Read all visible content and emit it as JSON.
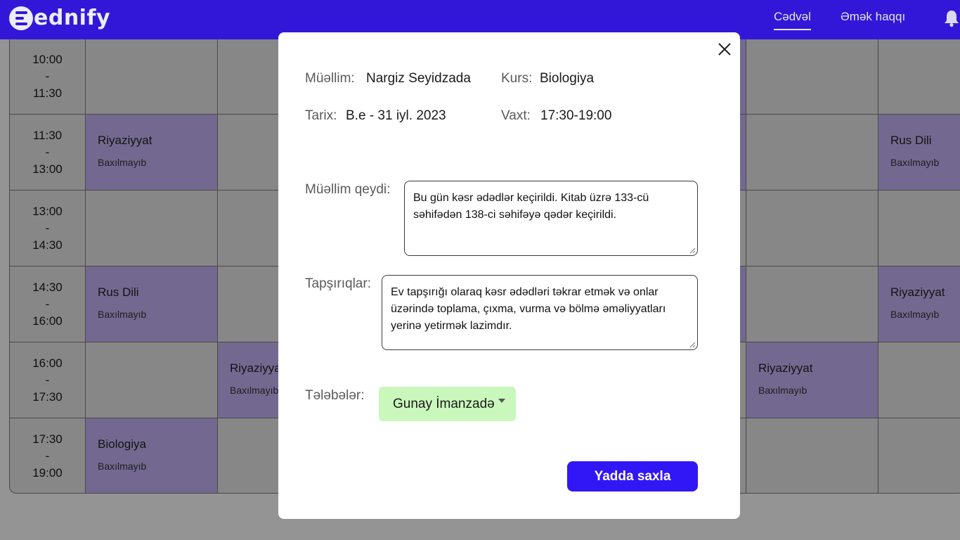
{
  "app": {
    "logo_text": "ednify",
    "nav": {
      "schedule": "Cədvəl",
      "salary": "Əmək haqqı"
    },
    "brand_color": "#3217d8"
  },
  "schedule": {
    "times": [
      {
        "start": "10:00",
        "sep": "-",
        "end": "11:30"
      },
      {
        "start": "11:30",
        "sep": "-",
        "end": "13:00"
      },
      {
        "start": "13:00",
        "sep": "-",
        "end": "14:30"
      },
      {
        "start": "14:30",
        "sep": "-",
        "end": "16:00"
      },
      {
        "start": "16:00",
        "sep": "-",
        "end": "17:30"
      },
      {
        "start": "17:30",
        "sep": "-",
        "end": "19:00"
      }
    ],
    "lessons": [
      {
        "row": 1,
        "col": 1,
        "subject": "Riyaziyyat",
        "status": "Baxılmayıb"
      },
      {
        "row": 1,
        "col": 7,
        "subject": "Rus Dili",
        "status": "Baxılmayıb"
      },
      {
        "row": 3,
        "col": 1,
        "subject": "Rus Dili",
        "status": "Baxılmayıb"
      },
      {
        "row": 3,
        "col": 7,
        "subject": "Riyaziyyat",
        "status": "Baxılmayıb"
      },
      {
        "row": 4,
        "col": 2,
        "subject": "Riyaziyyat",
        "status": "Baxılmayıb"
      },
      {
        "row": 4,
        "col": 6,
        "subject": "Riyaziyyat",
        "status": "Baxılmayıb"
      },
      {
        "row": 5,
        "col": 1,
        "subject": "Biologiya",
        "status": "Baxılmayıb"
      }
    ],
    "hidden_lesson_cells": [
      {
        "row": 0,
        "col": 5
      },
      {
        "row": 1,
        "col": 5
      },
      {
        "row": 3,
        "col": 5
      }
    ]
  },
  "modal": {
    "teacher_label": "Müəllim:",
    "teacher_value": "Nargiz Seyidzada",
    "course_label": "Kurs:",
    "course_value": "Biologiya",
    "date_label": "Tarix:",
    "date_value": "B.e - 31 iyl. 2023",
    "time_label": "Vaxt:",
    "time_value": "17:30-19:00",
    "note_label": "Müəllim qeydi:",
    "note_value": "Bu gün kəsr ədədlər keçirildi. Kitab üzrə 133-cü səhifədən 138-ci səhifəyə qədər keçirildi.",
    "tasks_label": "Tapşırıqlar:",
    "tasks_value": "Ev tapşırığı olaraq kəsr ədədləri təkrar etmək və onlar üzərində toplama, çıxma, vurma və bölmə əməliyyatları yerinə yetirmək lazimdır.",
    "students_label": "Tələbələr:",
    "student_selected": "Gunay İmanzadə",
    "save_label": "Yadda saxla"
  }
}
